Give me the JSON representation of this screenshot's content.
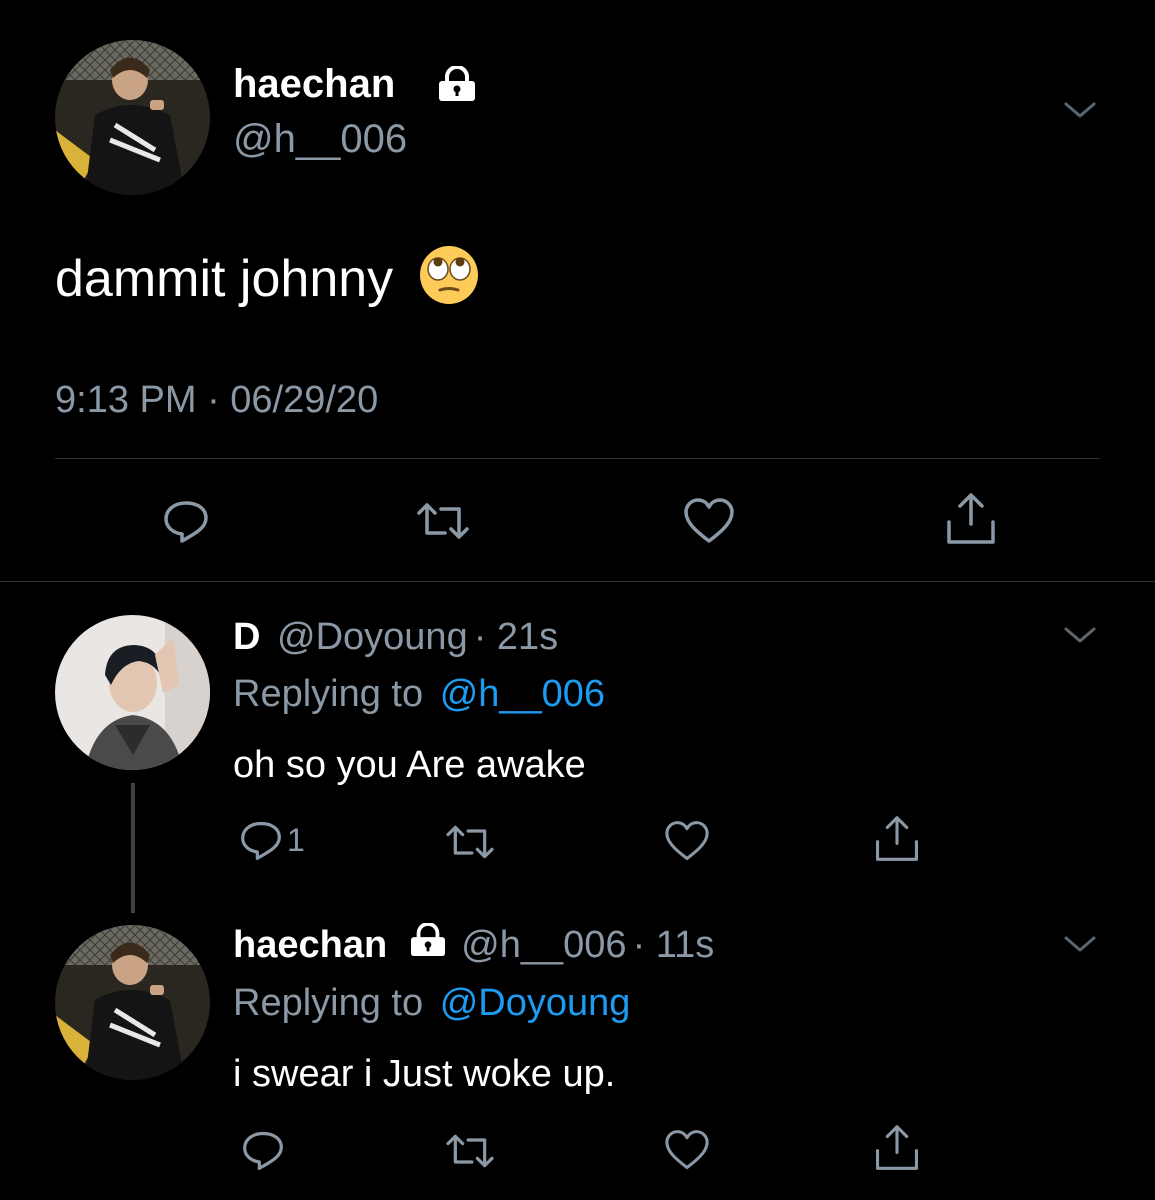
{
  "main_tweet": {
    "display_name": "haechan",
    "lock_icon": "lock-icon",
    "handle": "@h__006",
    "text": "dammit johnny",
    "emoji": "🙄",
    "timestamp": "9:13 PM · 06/29/20",
    "actions": [
      "reply-icon",
      "retweet-icon",
      "like-icon",
      "share-icon"
    ]
  },
  "replies": [
    {
      "display_name": "D",
      "handle": "@Doyoung",
      "time": "· 21s",
      "replying_label": "Replying to",
      "replying_to": "@h__006",
      "text": "oh so you Are awake",
      "reply_count": "1"
    },
    {
      "display_name": "haechan",
      "handle": "@h__006",
      "time": "· 11s",
      "replying_label": "Replying to",
      "replying_to": "@Doyoung",
      "text": "i swear i Just woke up."
    }
  ],
  "colors": {
    "background": "#000000",
    "muted": "#8b98a5",
    "link": "#1d9bf0",
    "divider": "#2f3336"
  }
}
